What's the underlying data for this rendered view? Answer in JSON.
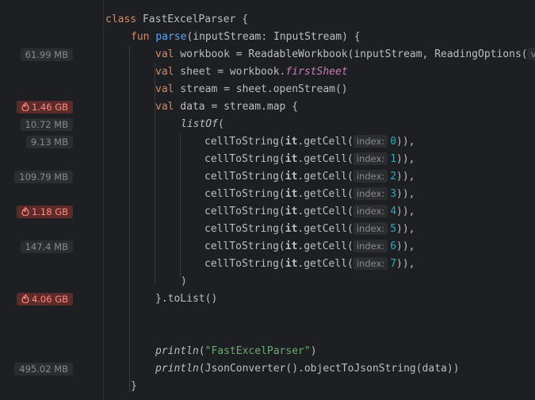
{
  "gutter": {
    "memory_badges": [
      {
        "row": 3,
        "text": "61.99 MB",
        "hot": false
      },
      {
        "row": 6,
        "text": "1.46 GB",
        "hot": true
      },
      {
        "row": 7,
        "text": "10.72 MB",
        "hot": false
      },
      {
        "row": 8,
        "text": "9.13 MB",
        "hot": false
      },
      {
        "row": 10,
        "text": "109.79 MB",
        "hot": false
      },
      {
        "row": 12,
        "text": "1.18 GB",
        "hot": true
      },
      {
        "row": 14,
        "text": "147.4 MB",
        "hot": false
      },
      {
        "row": 17,
        "text": "4.06 GB",
        "hot": true
      },
      {
        "row": 21,
        "text": "495.02 MB",
        "hot": false
      }
    ]
  },
  "code": {
    "class_kw": "class",
    "class_name": "FastExcelParser",
    "fun_kw": "fun",
    "fun_name": "parse",
    "fun_params": "(inputStream: InputStream) {",
    "val_kw": "val",
    "workbook_line": " workbook = ReadableWorkbook(inputStream, ReadingOptions(",
    "workbook_hint": "v",
    "sheet_prefix": " sheet = workbook.",
    "sheet_prop": "firstSheet",
    "stream_line": " stream = sheet.openStream()",
    "data_line": " data = stream.map {",
    "listof_fn": "listOf",
    "listof_open": "(",
    "cell_fn": "cellToString(",
    "it_kw": "it",
    "getcell": ".getCell(",
    "index_hint": "index:",
    "cells": [
      "0",
      "1",
      "2",
      "3",
      "4",
      "5",
      "6",
      "7"
    ],
    "cell_close": ")),",
    "paren_close": ")",
    "tolist_line": "}.toList()",
    "println_fn": "println",
    "println1_open": "(",
    "println1_str": "\"FastExcelParser\"",
    "println1_close": ")",
    "println2_rest": "(JsonConverter().objectToJsonString(data))",
    "fun_close": "}"
  }
}
